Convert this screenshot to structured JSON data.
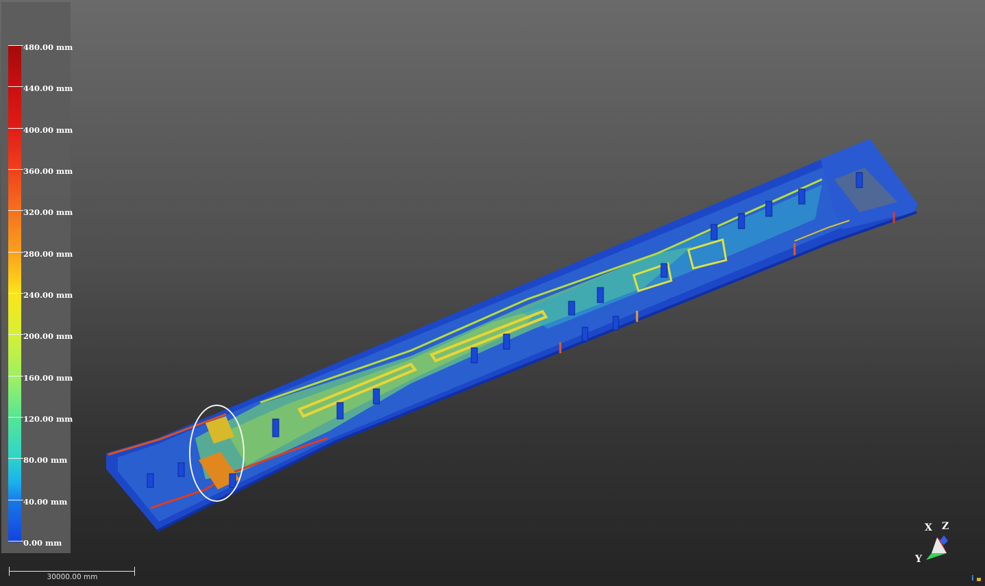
{
  "viewer": {
    "background_top": "#6a6a6a",
    "background_bottom": "#242424"
  },
  "legend": {
    "unit": "mm",
    "labels": [
      "480.00 mm",
      "440.00 mm",
      "400.00 mm",
      "360.00 mm",
      "320.00 mm",
      "280.00 mm",
      "240.00 mm",
      "200.00 mm",
      "160.00 mm",
      "120.00 mm",
      "80.00 mm",
      "40.00 mm",
      "0.00 mm"
    ],
    "range_max": 480,
    "range_min": 0,
    "color_max": "#a30a0a",
    "color_min": "#1442e0"
  },
  "scale_bar": {
    "label": "30000.00 mm"
  },
  "axes": {
    "x_label": "X",
    "y_label": "Y",
    "z_label": "Z",
    "x_color": "#e03030",
    "y_color": "#3ad45a",
    "z_color": "#3060f0"
  },
  "icons": {
    "info": "info-icon",
    "lock": "lock-icon"
  },
  "info_icon_glyph": "i"
}
